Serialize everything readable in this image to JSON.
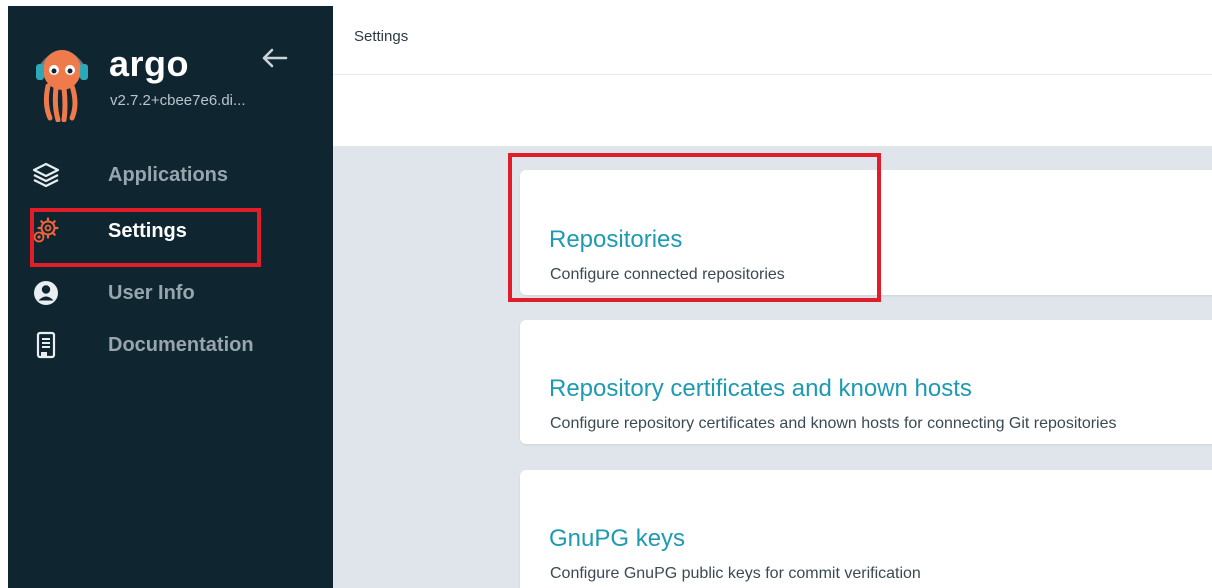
{
  "brand": {
    "name": "argo",
    "version": "v2.7.2+cbee7e6.di..."
  },
  "sidebar": {
    "items": [
      {
        "label": "Applications",
        "icon": "layers-icon"
      },
      {
        "label": "Settings",
        "icon": "gears-icon",
        "active": true
      },
      {
        "label": "User Info",
        "icon": "user-icon"
      },
      {
        "label": "Documentation",
        "icon": "book-icon"
      }
    ]
  },
  "header": {
    "title": "Settings"
  },
  "cards": [
    {
      "title": "Repositories",
      "description": "Configure connected repositories"
    },
    {
      "title": "Repository certificates and known hosts",
      "description": "Configure repository certificates and known hosts for connecting Git repositories"
    },
    {
      "title": "GnuPG keys",
      "description": "Configure GnuPG public keys for commit verification"
    }
  ],
  "colors": {
    "sidebar_bg": "#0f2530",
    "accent": "#1e9ab1",
    "highlight": "#e11d2a",
    "content_bg": "#dfe5ea",
    "settings_icon": "#f0643c",
    "logo_orange": "#ef7b4d"
  }
}
